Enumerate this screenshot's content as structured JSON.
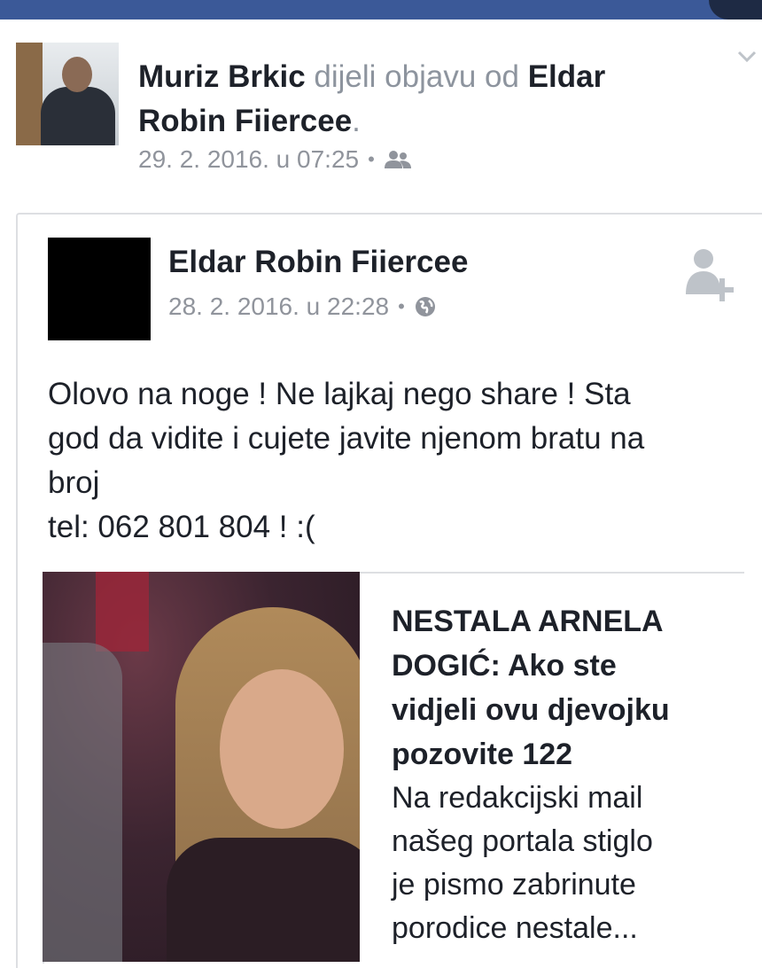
{
  "share_header": {
    "sharer_name": "Muriz Brkic",
    "action_text": "dijeli objavu od",
    "original_author": "Eldar Robin Fiiercee",
    "punctuation": ".",
    "timestamp": "29. 2. 2016. u 07:25",
    "audience_icon": "friends-icon"
  },
  "post": {
    "author_name": "Eldar Robin Fiiercee",
    "timestamp": "28. 2. 2016. u 22:28",
    "audience_icon": "globe-icon",
    "text_lines": [
      "Olovo na noge ! Ne lajkaj nego share ! Sta",
      "god da vidite i cujete javite njenom bratu na",
      "broj",
      "tel: 062 801 804 ! :("
    ]
  },
  "link_preview": {
    "title": "NESTALA ARNELA\nDOGIĆ: Ako ste\nvidjeli ovu djevojku\npozovite 122",
    "description": "Na redakcijski mail\nnašeg portala stiglo\nje pismo zabrinute\nporodice nestale..."
  },
  "colors": {
    "brand_blue": "#3b5998",
    "meta_gray": "#90949c",
    "text": "#1d2129"
  }
}
